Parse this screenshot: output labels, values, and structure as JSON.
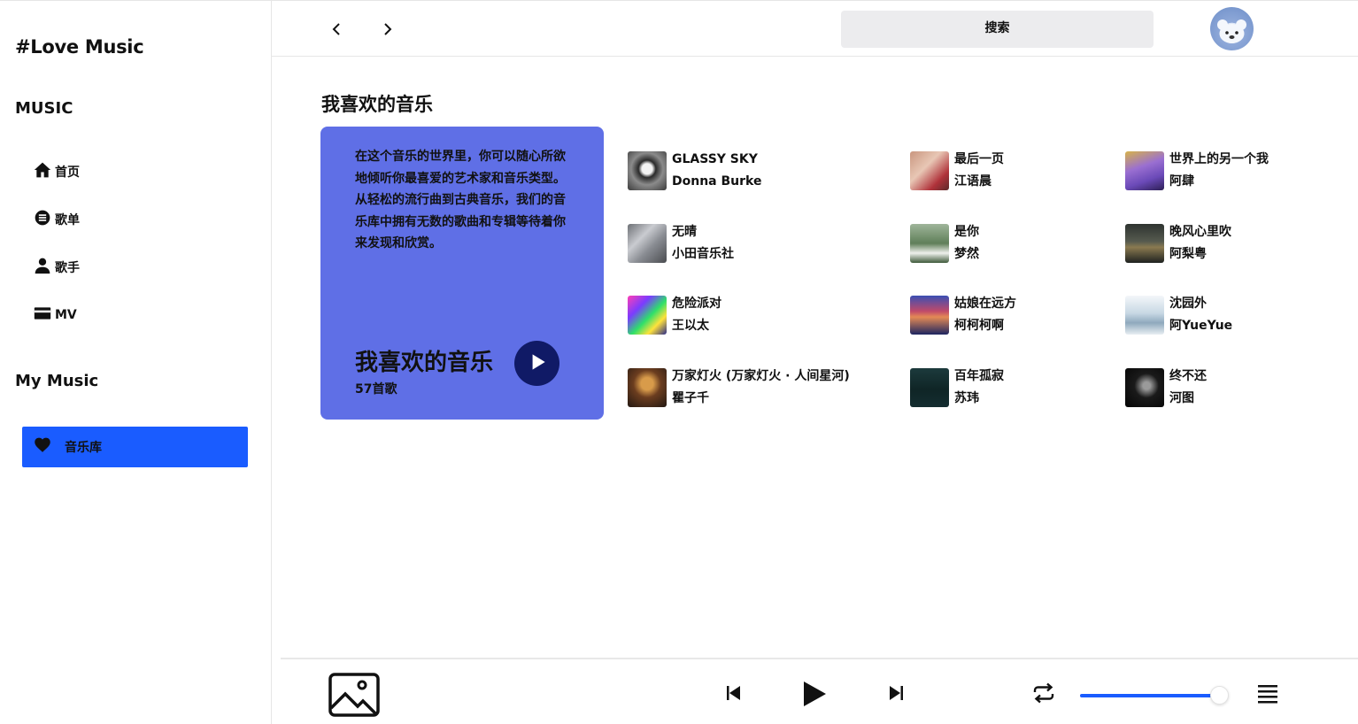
{
  "sidebar": {
    "brand": "#Love Music",
    "section_music": "MUSIC",
    "nav": [
      {
        "label": "首页",
        "icon": "home-icon"
      },
      {
        "label": "歌单",
        "icon": "playlist-icon"
      },
      {
        "label": "歌手",
        "icon": "person-icon"
      },
      {
        "label": "MV",
        "icon": "video-card-icon"
      }
    ],
    "section_my": "My Music",
    "library_label": "音乐库",
    "library_icon": "heart-icon",
    "library_color": "#1a5cff"
  },
  "header": {
    "back_icon": "chevron-left-icon",
    "forward_icon": "chevron-right-icon",
    "search_label": "搜索",
    "avatar_icon": "user-avatar"
  },
  "main": {
    "title": "我喜欢的音乐",
    "promo": {
      "description": "在这个音乐的世界里，你可以随心所欲地倾听你最喜爱的艺术家和音乐类型。从轻松的流行曲到古典音乐，我们的音乐库中拥有无数的歌曲和专辑等待着你来发现和欣赏。",
      "title": "我喜欢的音乐",
      "count": "57首歌",
      "bg_color": "#5f6fe6",
      "play_icon": "play-icon"
    },
    "songs": [
      {
        "title": "GLASSY SKY",
        "artist": "Donna Burke"
      },
      {
        "title": "最后一页",
        "artist": "江语晨"
      },
      {
        "title": "世界上的另一个我",
        "artist": "阿肆"
      },
      {
        "title": "无晴",
        "artist": "小田音乐社"
      },
      {
        "title": "是你",
        "artist": "梦然"
      },
      {
        "title": "晚风心里吹",
        "artist": "阿梨粤"
      },
      {
        "title": "危险派对",
        "artist": "王以太"
      },
      {
        "title": "姑娘在远方",
        "artist": "柯柯柯啊"
      },
      {
        "title": "沈园外",
        "artist": "阿YueYue"
      },
      {
        "title": "万家灯火 (万家灯火 · 人间星河)",
        "artist": "瞿子千"
      },
      {
        "title": "百年孤寂",
        "artist": "苏玮"
      },
      {
        "title": "终不还",
        "artist": "河图"
      }
    ]
  },
  "player": {
    "cover_icon": "image-placeholder-icon",
    "prev_icon": "skip-previous-icon",
    "play_icon": "play-icon",
    "next_icon": "skip-next-icon",
    "repeat_icon": "repeat-icon",
    "volume": 0.99,
    "playlist_icon": "queue-list-icon",
    "accent_color": "#1a5cff"
  }
}
